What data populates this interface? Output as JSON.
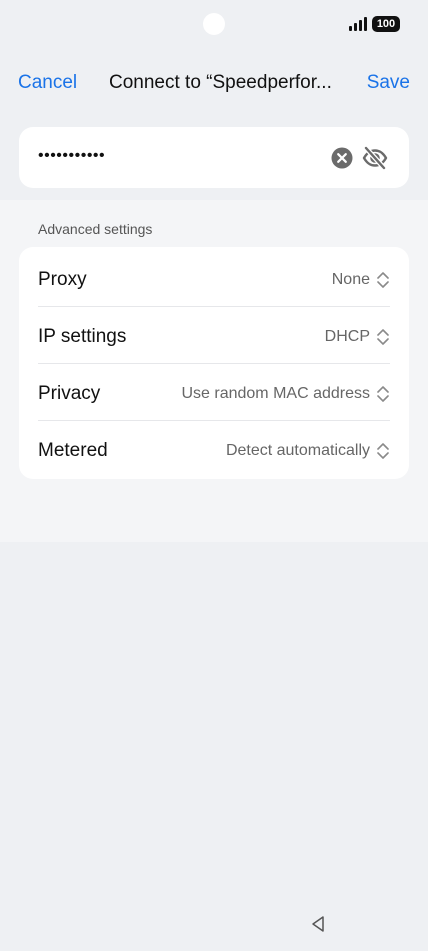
{
  "status_bar": {
    "battery": "100",
    "signal_icon": "cellular-signal-icon"
  },
  "header": {
    "cancel_label": "Cancel",
    "title": "Connect to “Speedperfor...",
    "save_label": "Save"
  },
  "password": {
    "value": "•••••••••••",
    "clear_icon": "clear-icon",
    "visibility_icon": "eye-slash-icon"
  },
  "advanced": {
    "section_label": "Advanced settings",
    "rows": [
      {
        "label": "Proxy",
        "value": "None"
      },
      {
        "label": "IP settings",
        "value": "DHCP"
      },
      {
        "label": "Privacy",
        "value": "Use random MAC address"
      },
      {
        "label": "Metered",
        "value": "Detect automatically"
      }
    ]
  },
  "colors": {
    "accent": "#1a73e8",
    "background": "#eef0f3",
    "card": "#ffffff"
  },
  "nav": {
    "back_icon": "back-triangle-icon"
  }
}
